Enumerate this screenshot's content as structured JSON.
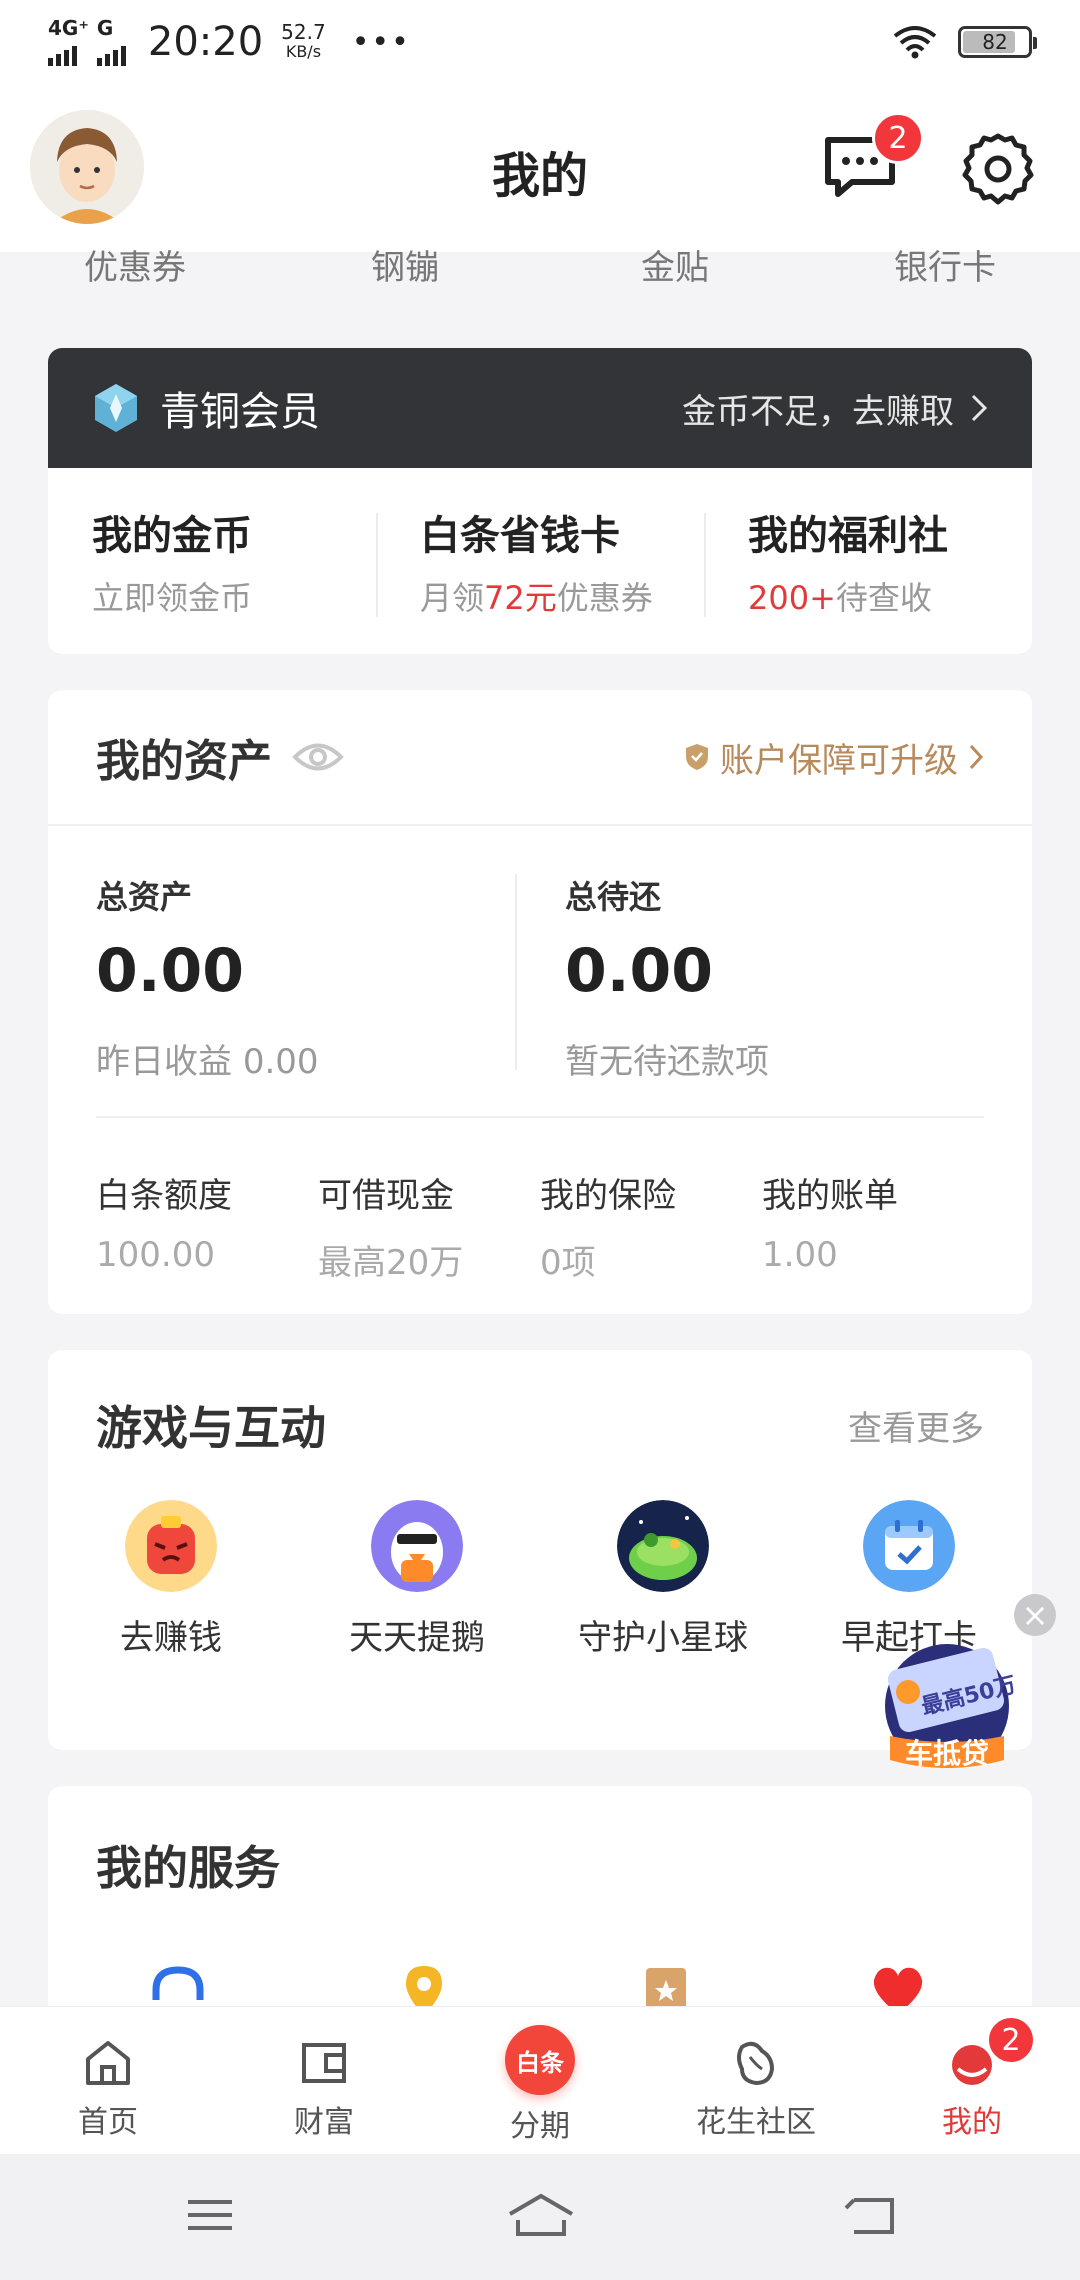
{
  "status_bar": {
    "network": "4G⁺",
    "network2": "G",
    "time": "20:20",
    "speed_value": "52.7",
    "speed_unit": "KB/s",
    "battery": "82",
    "battery_level": 0.82
  },
  "header": {
    "title": "我的",
    "message_badge": "2"
  },
  "quick_entries": [
    "优惠券",
    "钢镚",
    "金贴",
    "银行卡"
  ],
  "member": {
    "level": "青铜会员",
    "link": "金币不足，去赚取",
    "items": [
      {
        "title": "我的金币",
        "sub": "立即领金币"
      },
      {
        "title": "白条省钱卡",
        "sub_prefix": "月领",
        "sub_highlight": "72元",
        "sub_suffix": "优惠券"
      },
      {
        "title": "我的福利社",
        "sub_highlight": "200+",
        "sub_suffix": "待查收"
      }
    ]
  },
  "assets": {
    "title": "我的资产",
    "protection": "账户保障可升级",
    "total_label": "总资产",
    "total_value": "0.00",
    "yesterday_label": "昨日收益",
    "yesterday_value": "0.00",
    "repay_label": "总待还",
    "repay_value": "0.00",
    "repay_sub": "暂无待还款项",
    "bottom": [
      {
        "title": "白条额度",
        "value": "100.00"
      },
      {
        "title": "可借现金",
        "value": "最高20万"
      },
      {
        "title": "我的保险",
        "value": "0项"
      },
      {
        "title": "我的账单",
        "value": "1.00"
      }
    ]
  },
  "games": {
    "title": "游戏与互动",
    "more": "查看更多",
    "items": [
      {
        "label": "去赚钱",
        "icon": "red-mascot-icon"
      },
      {
        "label": "天天提鹅",
        "icon": "penguin-icon"
      },
      {
        "label": "守护小星球",
        "icon": "planet-icon"
      },
      {
        "label": "早起打卡",
        "icon": "calendar-icon"
      }
    ]
  },
  "float_ad": {
    "amount": "最高50万",
    "label": "车抵贷"
  },
  "services": {
    "title": "我的服务"
  },
  "tabs": [
    {
      "label": "首页",
      "icon": "home-icon"
    },
    {
      "label": "财富",
      "icon": "wallet-icon"
    },
    {
      "label": "分期",
      "icon": "baitiao-logo",
      "logo_text": "白条"
    },
    {
      "label": "花生社区",
      "icon": "peanut-icon"
    },
    {
      "label": "我的",
      "icon": "profile-icon",
      "badge": "2",
      "active": true
    }
  ],
  "colors": {
    "accent_red": "#e23a3a",
    "member_bar": "#333437",
    "gold": "#b8895a"
  }
}
